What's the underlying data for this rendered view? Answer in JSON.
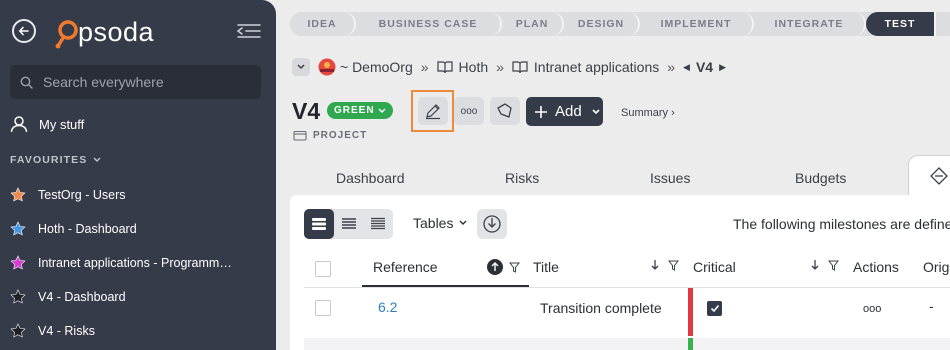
{
  "sidebar": {
    "logo_text": "psoda",
    "search_placeholder": "Search everywhere",
    "my_stuff": "My stuff",
    "favourites_header": "FAVOURITES",
    "favourites": [
      {
        "label": "TestOrg - Users",
        "star_color": "#f0894a"
      },
      {
        "label": "Hoth - Dashboard",
        "star_color": "#4a97e8"
      },
      {
        "label": "Intranet applications - Programme Dashboard",
        "star_color": "#d83bd2"
      },
      {
        "label": "V4 - Dashboard",
        "star_color": "#1c1f26"
      },
      {
        "label": "V4 - Risks",
        "star_color": "#1c1f26"
      }
    ]
  },
  "lifecycle": {
    "steps": [
      "IDEA",
      "BUSINESS CASE",
      "PLAN",
      "DESIGN",
      "IMPLEMENT",
      "INTEGRATE",
      "TEST"
    ],
    "active": "TEST"
  },
  "breadcrumb": {
    "org": "~ DemoOrg",
    "portfolio": "Hoth",
    "programme": "Intranet applications",
    "project": "V4"
  },
  "project": {
    "title": "V4",
    "status": "GREEN",
    "type": "PROJECT",
    "add_label": "Add",
    "summary_link": "Summary ›"
  },
  "tabs": [
    "Dashboard",
    "Risks",
    "Issues",
    "Budgets"
  ],
  "table": {
    "tables_label": "Tables",
    "description": "The following milestones are defined",
    "headers": [
      "Reference",
      "Title",
      "Critical",
      "Actions",
      "Orig"
    ],
    "rows": [
      {
        "reference": "6.2",
        "title": "Transition complete",
        "critical": true,
        "actions": "ooo",
        "orig": "-"
      }
    ]
  }
}
